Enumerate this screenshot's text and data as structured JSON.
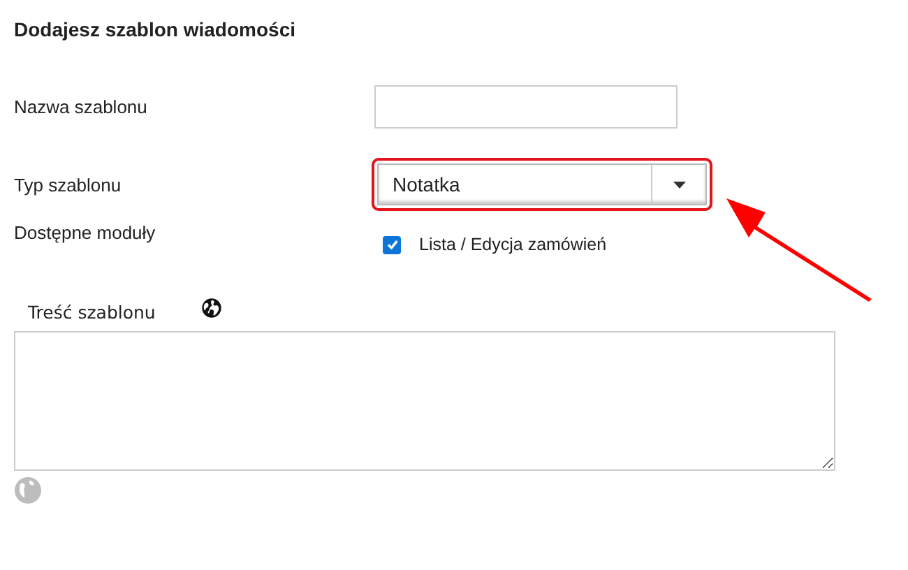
{
  "title": "Dodajesz szablon wiadomości",
  "name_field": {
    "label": "Nazwa szablonu"
  },
  "type_field": {
    "label": "Typ szablonu",
    "value": "Notatka",
    "highlighted": true
  },
  "modules": {
    "label": "Dostępne moduły",
    "options": [
      {
        "label": "Lista / Edycja zamówień",
        "checked": true
      }
    ]
  },
  "content": {
    "label": "Treść szablonu"
  }
}
